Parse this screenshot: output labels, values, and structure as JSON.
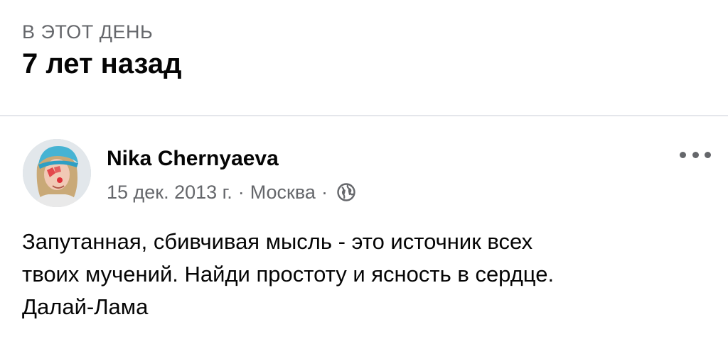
{
  "memory": {
    "section_label": "В ЭТОТ ДЕНЬ",
    "years_ago": "7 лет назад"
  },
  "post": {
    "author": "Nika Chernyaeva",
    "date": "15 дек. 2013 г.",
    "separator": "·",
    "location": "Москва",
    "audience_icon": "globe-icon",
    "more_icon": "more-horizontal-icon",
    "text_lines": [
      "Запутанная, сбивчивая мысль - это источник всех",
      "твоих мучений. Найди простоту и ясность в сердце.",
      "Далай-Лама"
    ]
  },
  "colors": {
    "primary_text": "#050505",
    "secondary_text": "#65676b",
    "divider": "#e4e6eb"
  }
}
